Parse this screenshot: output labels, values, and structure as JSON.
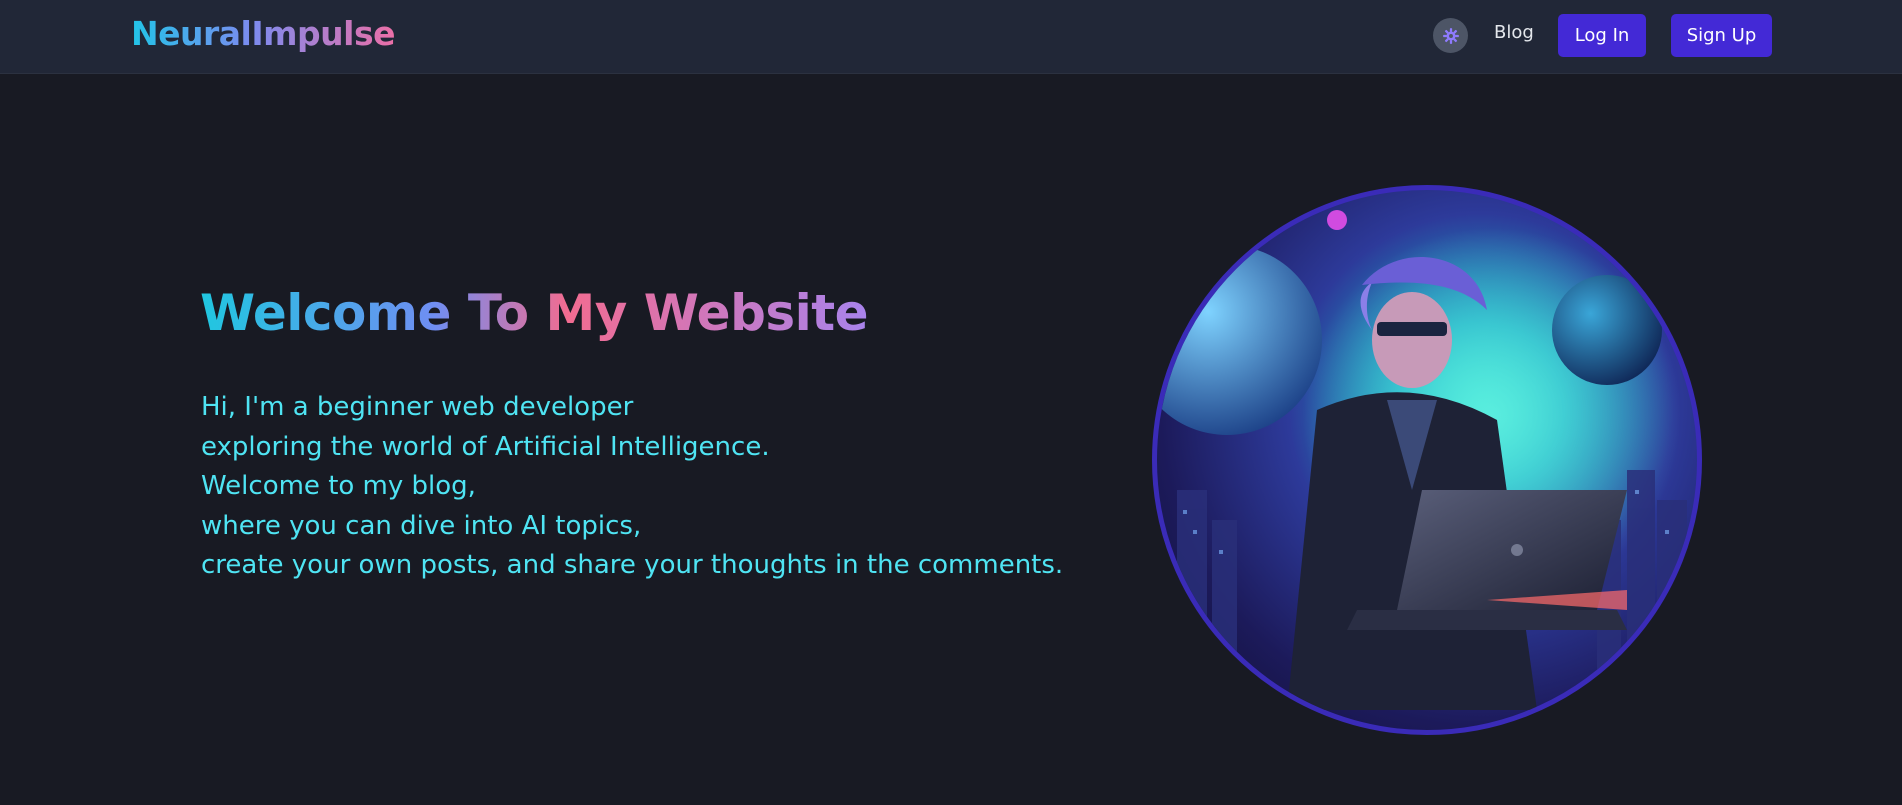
{
  "header": {
    "logo_text": "NeuralImpulse",
    "theme_toggle_icon": "gear-icon",
    "nav_blog": "Blog",
    "login_label": "Log In",
    "signup_label": "Sign Up"
  },
  "hero": {
    "title": "Welcome To My Website",
    "intro_lines": [
      "Hi, I'm a beginner web developer",
      "exploring the world of Artificial Intelligence.",
      "Welcome to my blog,",
      "where you can dive into AI topics,",
      "create your own posts, and share your thoughts in the comments."
    ]
  },
  "colors": {
    "page_background": "#181a23",
    "navbar_background": "#212737",
    "button_accent": "#4329d6",
    "intro_text": "#4fe4f3",
    "avatar_ring": "#3a2bb8"
  }
}
